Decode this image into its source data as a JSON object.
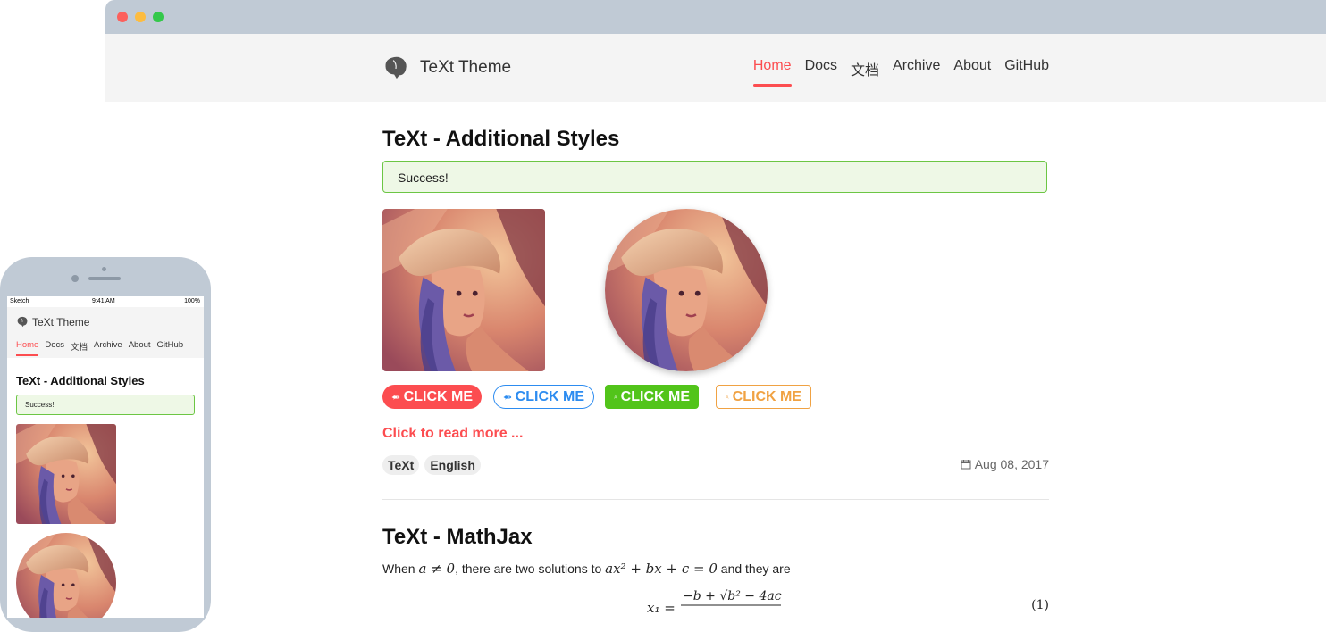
{
  "site": {
    "title": "TeXt Theme",
    "nav": [
      "Home",
      "Docs",
      "文档",
      "Archive",
      "About",
      "GitHub"
    ],
    "active_nav": "Home"
  },
  "post1": {
    "title": "TeXt - Additional Styles",
    "alert": "Success!",
    "buttons": [
      "CLICK ME",
      "CLICK ME",
      "CLICK ME",
      "CLICK ME"
    ],
    "read_more": "Click to read more ...",
    "tags": [
      "TeXt",
      "English"
    ],
    "date": "Aug 08, 2017"
  },
  "post2": {
    "title": "TeXt - MathJax",
    "intro_prefix": "When",
    "intro_cond": "a ≠ 0",
    "intro_middle": ", there are two solutions to",
    "intro_eq": "ax² + bx + c = 0",
    "intro_suffix": "and they are",
    "equation_number": "(1)"
  },
  "mobile": {
    "status_left": "Sketch",
    "status_time": "9:41 AM",
    "status_right": "100%",
    "title": "TeXt Theme",
    "nav": [
      "Home",
      "Docs",
      "文档",
      "Archive",
      "About",
      "GitHub"
    ],
    "post_title": "TeXt - Additional Styles",
    "alert": "Success!"
  },
  "colors": {
    "accent": "#fc4d50",
    "header_bg": "#f4f4f4",
    "titlebar": "#c0cad5",
    "success_border": "#6cc644",
    "success_bg": "#eef8e6",
    "blue": "#2d8cf0",
    "green": "#52c41a",
    "orange": "#f0a243"
  }
}
